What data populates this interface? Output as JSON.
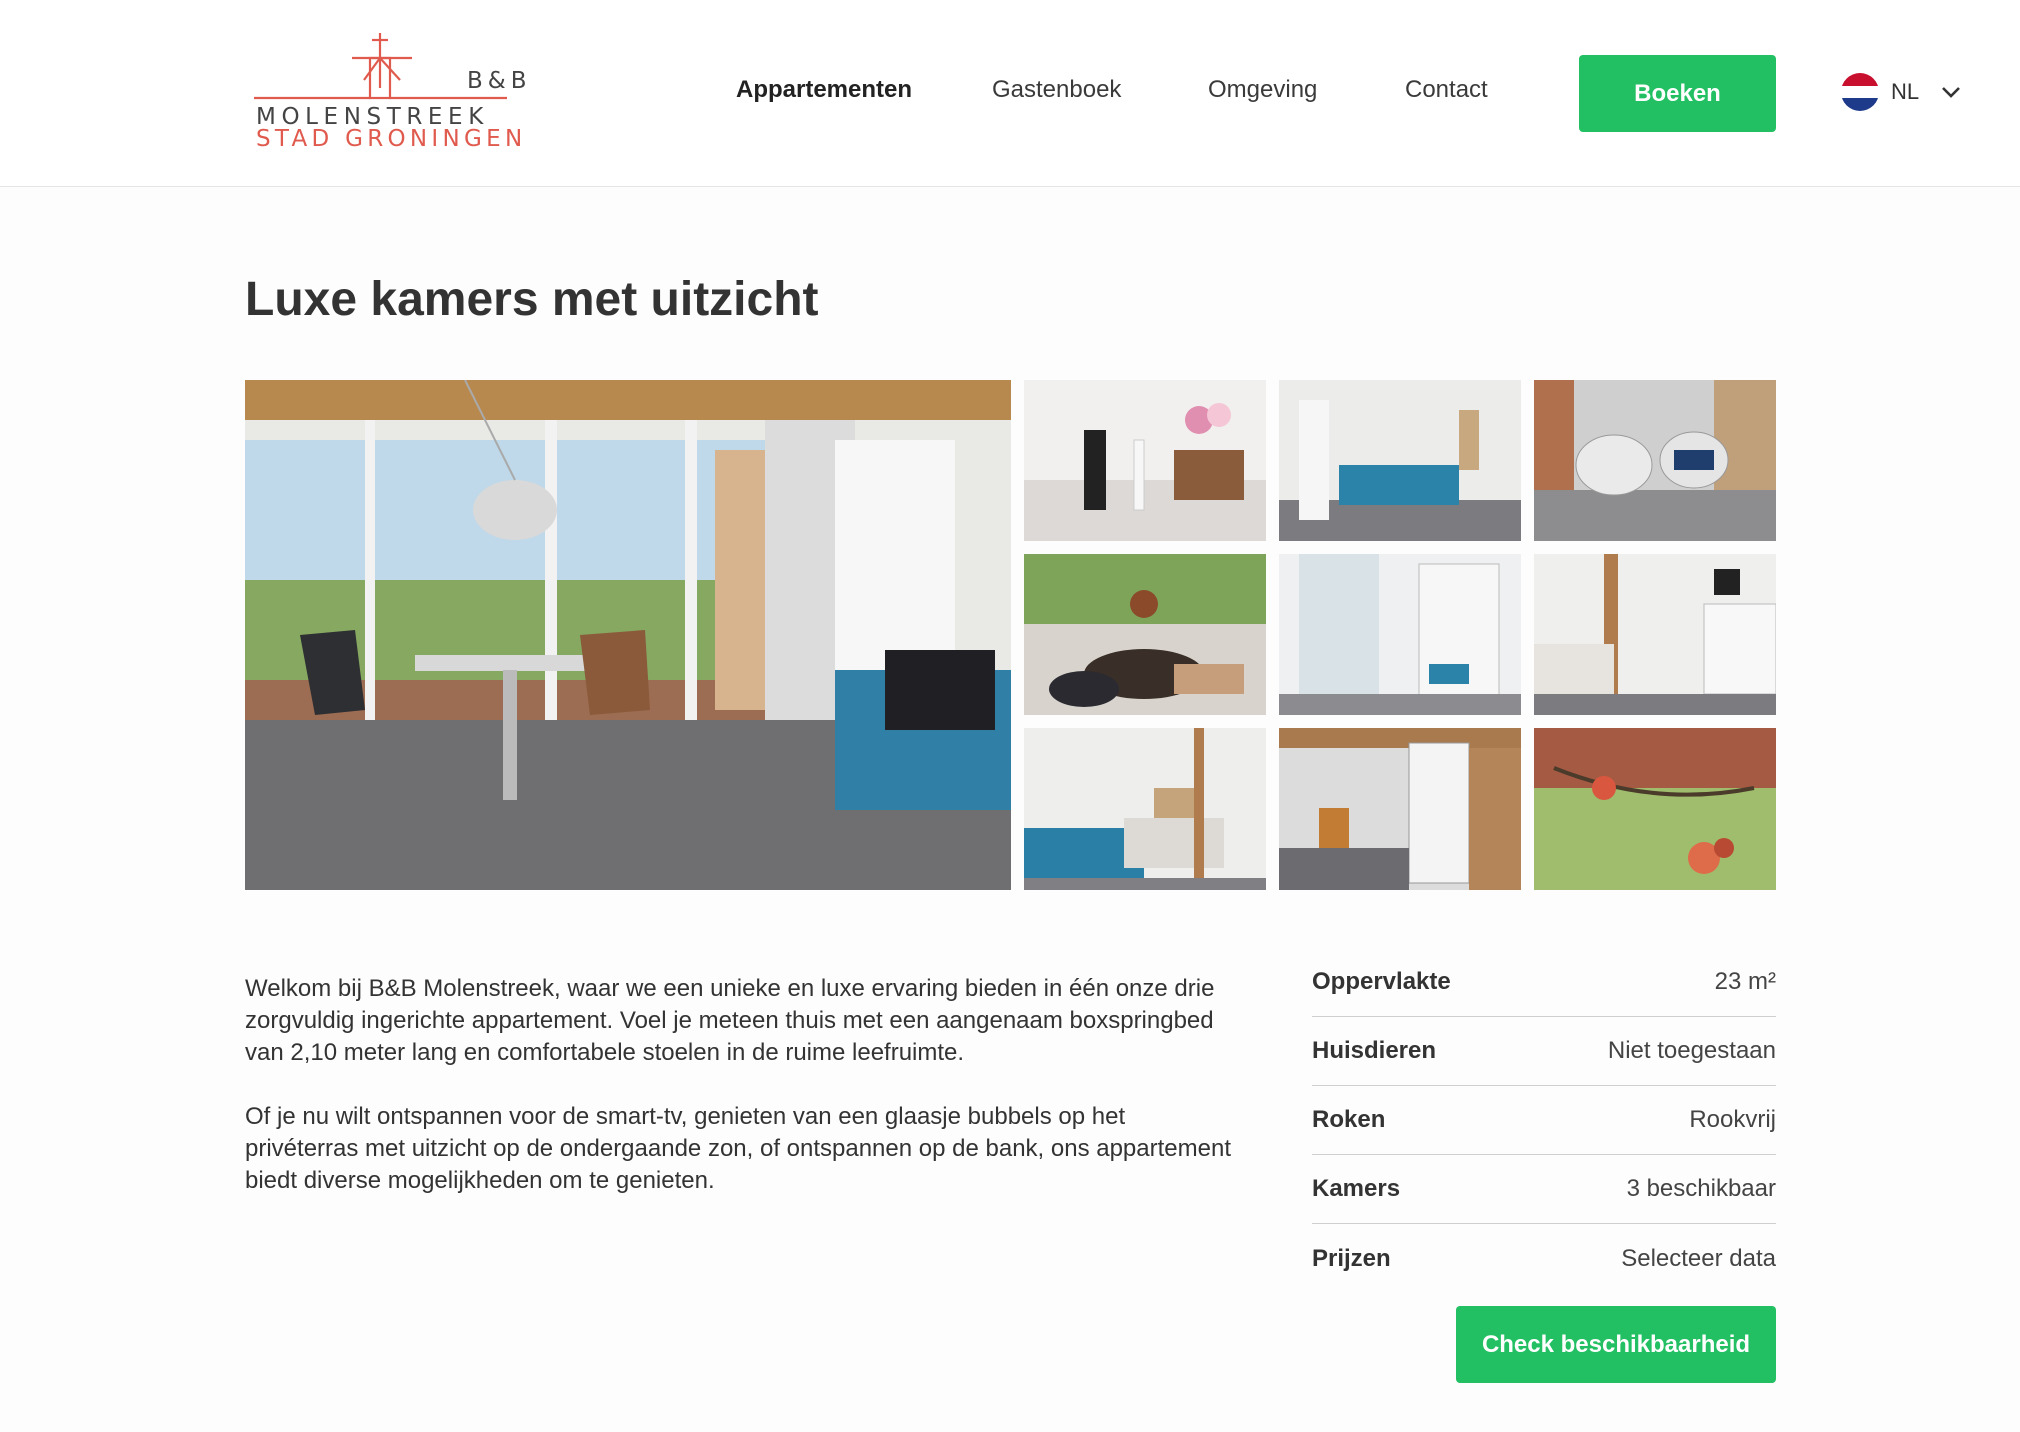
{
  "header": {
    "logo": {
      "top": "B&B",
      "line1": "MOLENSTREEK",
      "line2": "STAD GRONINGEN"
    },
    "nav": [
      {
        "label": "Appartementen",
        "active": true
      },
      {
        "label": "Gastenboek",
        "active": false
      },
      {
        "label": "Omgeving",
        "active": false
      },
      {
        "label": "Contact",
        "active": false
      }
    ],
    "book_label": "Boeken",
    "language": {
      "code": "NL",
      "icon": "flag-nl-icon"
    }
  },
  "page": {
    "title": "Luxe kamers met uitzicht"
  },
  "gallery": {
    "photos": [
      "Woonkamer met tafel, stoelen en uitzicht",
      "Fles bubbels met glazen en bloemen",
      "Blauwe bank in de kamer",
      "Stoelen op het terras",
      "Ontbijt op tafel buiten",
      "Badkamer met douche",
      "Slaapkamer met keukentje",
      "Boxspringbed met blauwe bank",
      "Open deuren naar het terras",
      "Appels aan de boom"
    ]
  },
  "description": {
    "paragraphs": [
      "Welkom bij B&B Molenstreek, waar we een unieke en luxe ervaring bieden in één onze drie zorgvuldig ingerichte appartement. Voel je meteen thuis met een aangenaam boxspringbed van 2,10 meter lang en comfortabele stoelen in de ruime leefruimte.",
      "Of je nu wilt ontspannen voor de smart-tv, genieten van een glaasje bubbels op het privéterras met uitzicht op de ondergaande zon, of ontspannen op de bank, ons appartement biedt diverse mogelijkheden om te genieten."
    ]
  },
  "specs": [
    {
      "label": "Oppervlakte",
      "value": "23 m²"
    },
    {
      "label": "Huisdieren",
      "value": "Niet toegestaan"
    },
    {
      "label": "Roken",
      "value": "Rookvrij"
    },
    {
      "label": "Kamers",
      "value": "3 beschikbaar"
    },
    {
      "label": "Prijzen",
      "value": "Selecteer data"
    }
  ],
  "check_label": "Check beschikbaarheid",
  "colors": {
    "accent": "#23c063",
    "logo_red": "#e05a4e",
    "text": "#2d2d2d"
  }
}
